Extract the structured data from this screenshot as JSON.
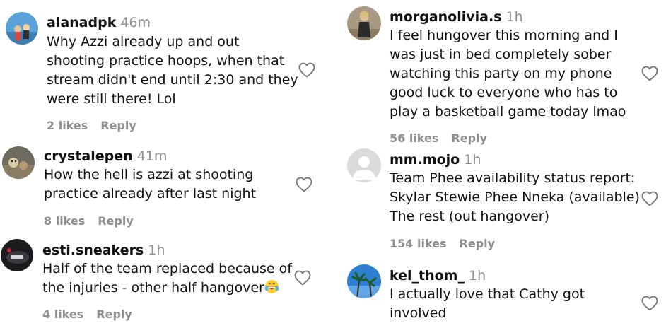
{
  "comments": [
    {
      "username": "alanadpk",
      "time": "46m",
      "lines": [
        "Why Azzi already up and out",
        "shooting practice hoops, when that",
        "stream didn't end until 2:30 and they",
        "were still there! Lol"
      ],
      "likes": "2 likes",
      "reply": "Reply"
    },
    {
      "username": "crystalepen",
      "time": "41m",
      "lines": [
        "How the hell is azzi at shooting",
        "practice already after last night"
      ],
      "likes": "8 likes",
      "reply": "Reply"
    },
    {
      "username": "esti.sneakers",
      "time": "1h",
      "lines": [
        "Half of the team replaced because of",
        "the injuries - other half hangover"
      ],
      "likes": "4 likes",
      "reply": "Reply",
      "emoji": "grinning-sweat-emoji"
    },
    {
      "username": "morganolivia.s",
      "time": "1h",
      "lines": [
        "I feel hungover this morning and I",
        "was just in bed completely sober",
        "watching this party on my phone",
        "good luck to everyone who has to",
        "play a basketball game today lmao"
      ],
      "likes": "56 likes",
      "reply": "Reply"
    },
    {
      "username": "mm.mojo",
      "time": "1h",
      "lines": [
        "Team Phee availability status report:",
        "Skylar Stewie Phee Nneka (available)",
        "The rest (out hangover)"
      ],
      "likes": "154 likes",
      "reply": "Reply"
    },
    {
      "username": "kel_thom_",
      "time": "1h",
      "lines": [
        "I actually love that Cathy got",
        "involved"
      ],
      "likes": "",
      "reply": ""
    }
  ],
  "icons": {
    "like": "heart-outline-icon",
    "default_avatar": "default-profile-icon"
  },
  "colors": {
    "meta_text": "#8e8e8e",
    "username": "#111111",
    "heart_stroke": "#737373"
  }
}
